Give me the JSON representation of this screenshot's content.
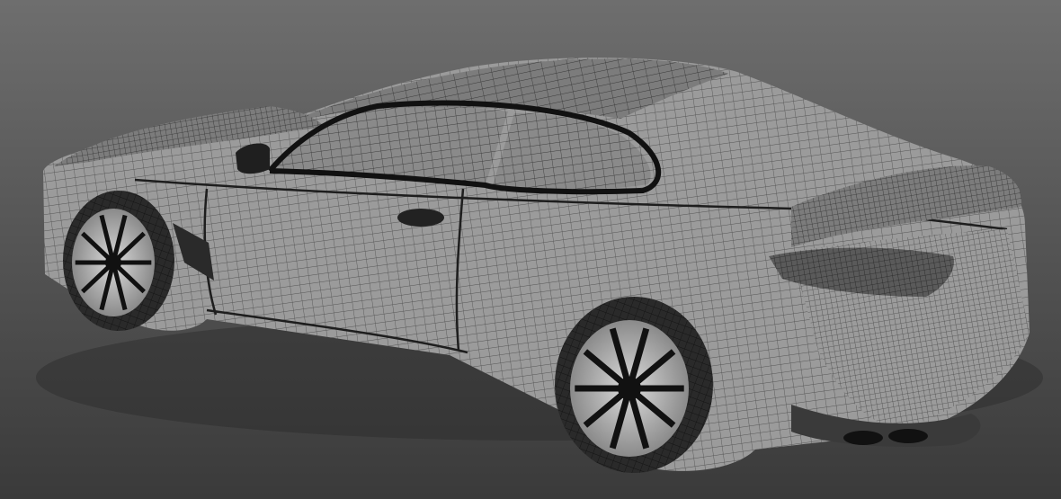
{
  "viewport": {
    "background_top": "#6e6e6e",
    "background_bottom": "#3a3a3a"
  },
  "car": {
    "body_color": "#9b9b9b",
    "body_shade": "#7c7c7c",
    "glass_color": "#8a8a8a",
    "wire_color": "#1e1e1e",
    "tire_color": "#2a2a2a",
    "rim_color": "#111111",
    "taillight_color": "#5a5a5a"
  }
}
